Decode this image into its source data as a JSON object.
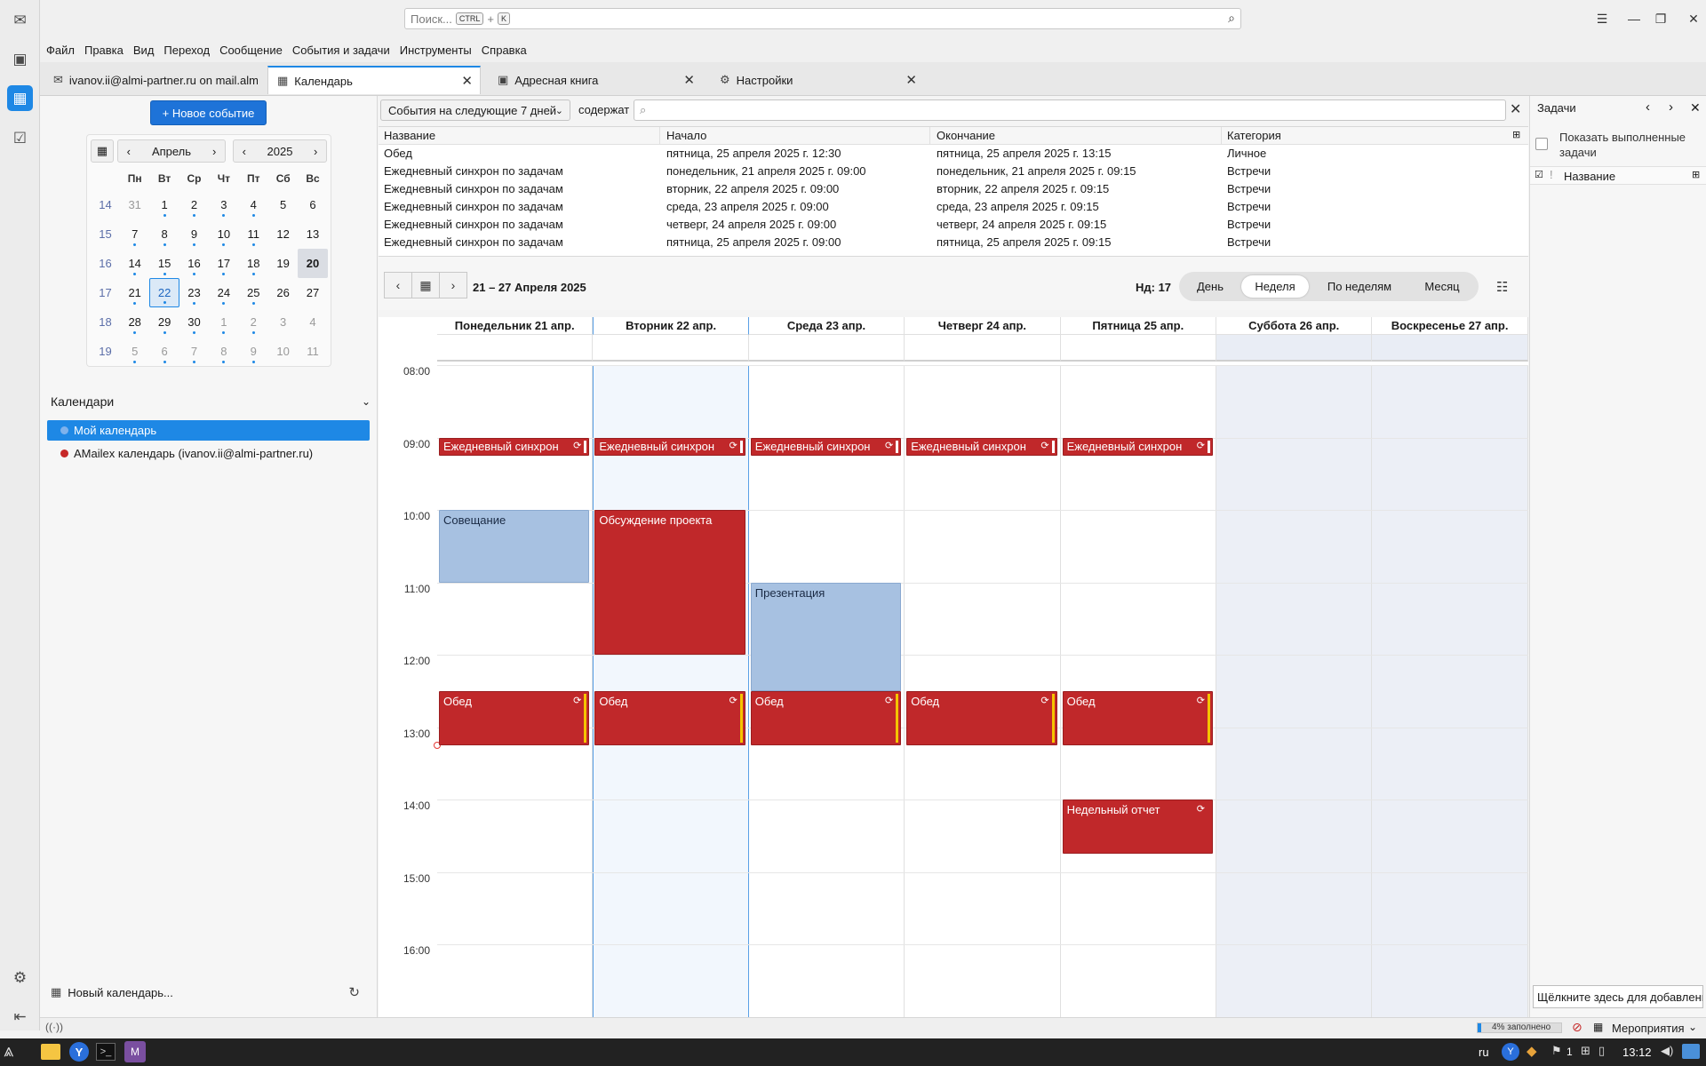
{
  "search": {
    "placeholder": "Поиск...",
    "kbd1": "CTRL",
    "plus": "+",
    "kbd2": "K"
  },
  "menu": [
    "Файл",
    "Правка",
    "Вид",
    "Переход",
    "Сообщение",
    "События и задачи",
    "Инструменты",
    "Справка"
  ],
  "tabs": [
    {
      "label": "ivanov.ii@almi-partner.ru on mail.almi"
    },
    {
      "label": "Календарь"
    },
    {
      "label": "Адресная книга"
    },
    {
      "label": "Настройки"
    }
  ],
  "new_event_label": "+ Новое событие",
  "minimonth": {
    "month": "Апрель",
    "year": "2025",
    "weekdays": [
      "Пн",
      "Вт",
      "Ср",
      "Чт",
      "Пт",
      "Сб",
      "Вс"
    ],
    "weeks": [
      {
        "wk": "14",
        "days": [
          "31",
          "1",
          "2",
          "3",
          "4",
          "5",
          "6"
        ]
      },
      {
        "wk": "15",
        "days": [
          "7",
          "8",
          "9",
          "10",
          "11",
          "12",
          "13"
        ]
      },
      {
        "wk": "16",
        "days": [
          "14",
          "15",
          "16",
          "17",
          "18",
          "19",
          "20"
        ]
      },
      {
        "wk": "17",
        "days": [
          "21",
          "22",
          "23",
          "24",
          "25",
          "26",
          "27"
        ]
      },
      {
        "wk": "18",
        "days": [
          "28",
          "29",
          "30",
          "1",
          "2",
          "3",
          "4"
        ]
      },
      {
        "wk": "19",
        "days": [
          "5",
          "6",
          "7",
          "8",
          "9",
          "10",
          "11"
        ]
      }
    ]
  },
  "calendars": {
    "header": "Календари",
    "items": [
      {
        "name": "Мой календарь",
        "color": "#7fb2ec"
      },
      {
        "name": "AMailex календарь (ivanov.ii@almi-partner.ru)",
        "color": "#c62828"
      }
    ],
    "new_label": "Новый календарь..."
  },
  "filter": {
    "select": "События на следующие 7 дней",
    "contains": "содержат"
  },
  "unifinder": {
    "columns": [
      "Название",
      "Начало",
      "Окончание",
      "Категория"
    ],
    "rows": [
      [
        "Обед",
        "пятница, 25 апреля 2025 г. 12:30",
        "пятница, 25 апреля 2025 г. 13:15",
        "Личное"
      ],
      [
        "Ежедневный синхрон по задачам",
        "понедельник, 21 апреля 2025 г. 09:00",
        "понедельник, 21 апреля 2025 г. 09:15",
        "Встречи"
      ],
      [
        "Ежедневный синхрон по задачам",
        "вторник, 22 апреля 2025 г. 09:00",
        "вторник, 22 апреля 2025 г. 09:15",
        "Встречи"
      ],
      [
        "Ежедневный синхрон по задачам",
        "среда, 23 апреля 2025 г. 09:00",
        "среда, 23 апреля 2025 г. 09:15",
        "Встречи"
      ],
      [
        "Ежедневный синхрон по задачам",
        "четверг, 24 апреля 2025 г. 09:00",
        "четверг, 24 апреля 2025 г. 09:15",
        "Встречи"
      ],
      [
        "Ежедневный синхрон по задачам",
        "пятница, 25 апреля 2025 г. 09:00",
        "пятница, 25 апреля 2025 г. 09:15",
        "Встречи"
      ]
    ]
  },
  "nav": {
    "range": "21 – 27 Апреля 2025",
    "week": "Нд: 17",
    "views": [
      "День",
      "Неделя",
      "По неделям",
      "Месяц"
    ]
  },
  "days": [
    "Понедельник 21 апр.",
    "Вторник 22 апр.",
    "Среда 23 апр.",
    "Четверг 24 апр.",
    "Пятница 25 апр.",
    "Суббота 26 апр.",
    "Воскресенье 27 апр."
  ],
  "hours": [
    "08:00",
    "09:00",
    "10:00",
    "11:00",
    "12:00",
    "13:00",
    "14:00",
    "15:00",
    "16:00"
  ],
  "events": [
    {
      "day": 0,
      "start": "09:00",
      "end": "09:15",
      "title": "Ежедневный синхрон",
      "color": "red"
    },
    {
      "day": 1,
      "start": "09:00",
      "end": "09:15",
      "title": "Ежедневный синхрон",
      "color": "red"
    },
    {
      "day": 2,
      "start": "09:00",
      "end": "09:15",
      "title": "Ежедневный синхрон",
      "color": "red"
    },
    {
      "day": 3,
      "start": "09:00",
      "end": "09:15",
      "title": "Ежедневный синхрон",
      "color": "red"
    },
    {
      "day": 4,
      "start": "09:00",
      "end": "09:15",
      "title": "Ежедневный синхрон",
      "color": "red"
    },
    {
      "day": 0,
      "start": "10:00",
      "end": "11:00",
      "title": "Совещание",
      "color": "blue"
    },
    {
      "day": 1,
      "start": "10:00",
      "end": "12:00",
      "title": "Обсуждение проекта",
      "color": "red"
    },
    {
      "day": 2,
      "start": "11:00",
      "end": "12:30",
      "title": "Презентация",
      "color": "blue"
    },
    {
      "day": 0,
      "start": "12:30",
      "end": "13:15",
      "title": "Обед",
      "color": "red"
    },
    {
      "day": 1,
      "start": "12:30",
      "end": "13:15",
      "title": "Обед",
      "color": "red"
    },
    {
      "day": 2,
      "start": "12:30",
      "end": "13:15",
      "title": "Обед",
      "color": "red"
    },
    {
      "day": 3,
      "start": "12:30",
      "end": "13:15",
      "title": "Обед",
      "color": "red"
    },
    {
      "day": 4,
      "start": "12:30",
      "end": "13:15",
      "title": "Обед",
      "color": "red"
    },
    {
      "day": 4,
      "start": "14:00",
      "end": "14:45",
      "title": "Недельный отчет",
      "color": "red"
    }
  ],
  "tasks": {
    "title": "Задачи",
    "show_completed": "Показать выполненные задачи",
    "col_name": "Название",
    "add_hint": "Щёлкните здесь для добавлени"
  },
  "status": {
    "quota": "4% заполнено",
    "events_label": "Мероприятия"
  },
  "taskbar": {
    "lang": "ru",
    "count": "1",
    "time": "13:12"
  }
}
